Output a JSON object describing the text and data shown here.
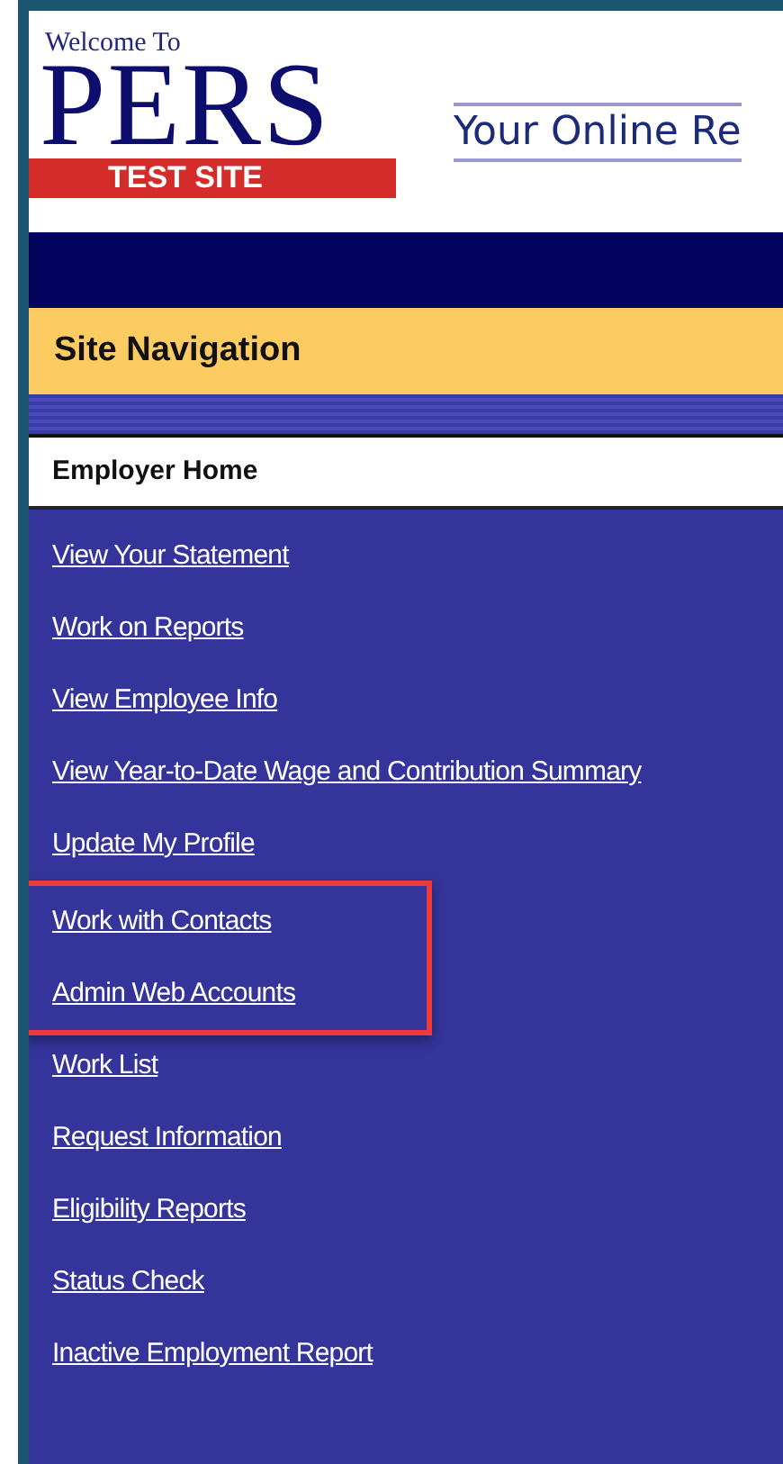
{
  "header": {
    "logo": {
      "welcome": "Welcome To",
      "name": "PERS",
      "badge": "TEST SITE"
    },
    "title": "Your Online Re"
  },
  "navigation": {
    "heading": "Site Navigation",
    "section": "Employer Home",
    "links": [
      {
        "label": "View Your Statement",
        "highlighted": false
      },
      {
        "label": "Work on Reports",
        "highlighted": false
      },
      {
        "label": "View Employee Info",
        "highlighted": false
      },
      {
        "label": "View Year-to-Date Wage and Contribution Summary",
        "highlighted": false
      },
      {
        "label": "Update My Profile",
        "highlighted": false
      },
      {
        "label": "Work with Contacts",
        "highlighted": true
      },
      {
        "label": "Admin Web Accounts",
        "highlighted": true
      },
      {
        "label": "Work List",
        "highlighted": false
      },
      {
        "label": "Request Information",
        "highlighted": false
      },
      {
        "label": "Eligibility Reports",
        "highlighted": false
      },
      {
        "label": "Status Check",
        "highlighted": false
      },
      {
        "label": "Inactive Employment Report",
        "highlighted": false
      }
    ]
  }
}
